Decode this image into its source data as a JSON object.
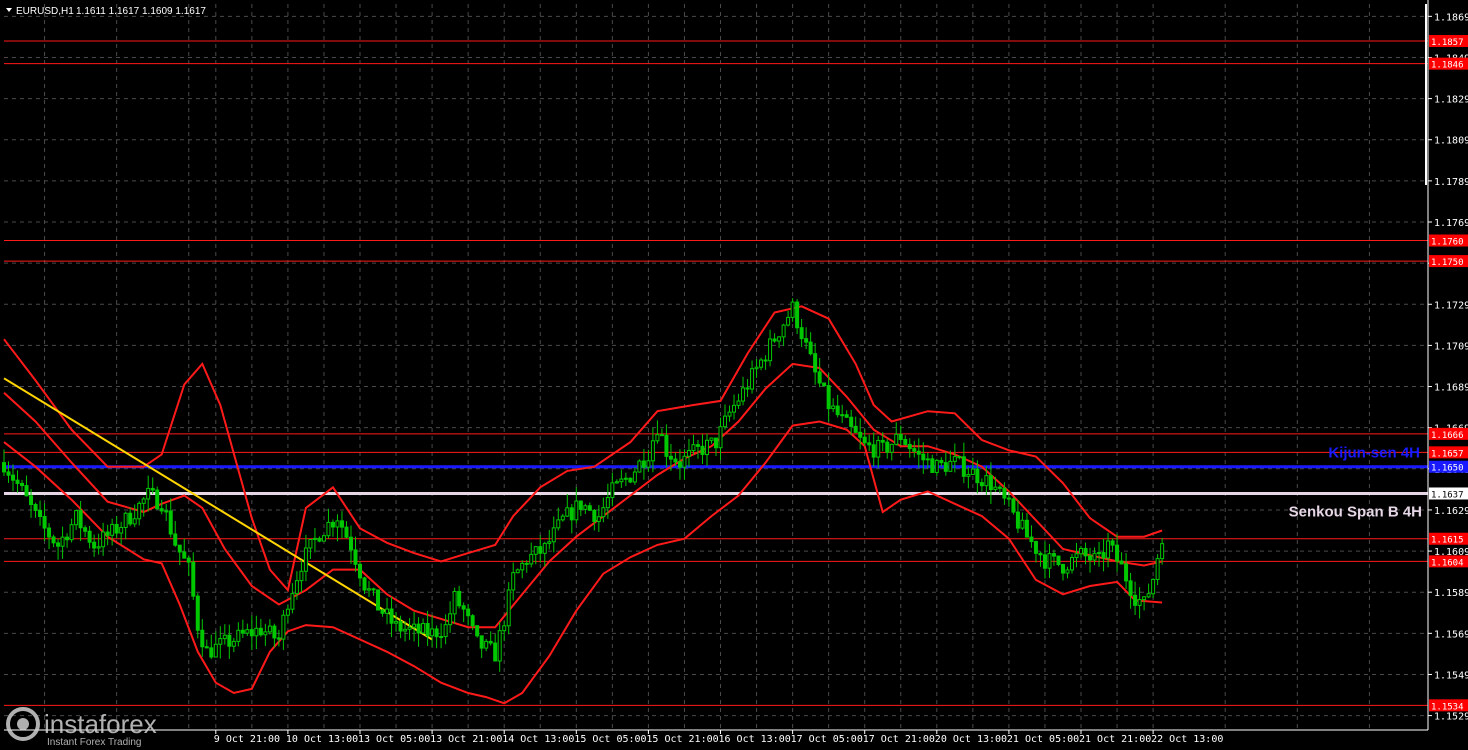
{
  "header": {
    "symbol": "EURUSD,H1",
    "ohlc": "1.1611 1.1617 1.1609 1.1617"
  },
  "watermark": {
    "brand": "instaforex",
    "tagline": "Instant Forex Trading"
  },
  "colors": {
    "background": "#000000",
    "grid": "#4a4a4a",
    "axis": "#ffffff",
    "candle": "#00c800",
    "bollinger": "#ff1a1a",
    "level_line": "#ff1a1a",
    "trend_line": "#ffd400",
    "kijun": "#1a1aff",
    "senkou": "#e6d6e6",
    "label_box": "#ff0000",
    "label_text": "#ffffff"
  },
  "chart_data": {
    "type": "candlestick",
    "symbol": "EURUSD",
    "timeframe": "H1",
    "ylim": [
      1.1522,
      1.1875
    ],
    "grid": true,
    "y_ticks": [
      "1.1869",
      "1.1849",
      "1.1829",
      "1.1809",
      "1.1789",
      "1.1769",
      "1.1749",
      "1.1729",
      "1.1709",
      "1.1689",
      "1.1669",
      "1.1649",
      "1.1629",
      "1.1609",
      "1.1589",
      "1.1569",
      "1.1549",
      "1.1529"
    ],
    "x_ticks": [
      {
        "label": "9 Oct 21:00",
        "x": 12
      },
      {
        "label": "10 Oct 13:00",
        "x": 28
      },
      {
        "label": "13 Oct 05:00",
        "x": 44
      },
      {
        "label": "13 Oct 21:00",
        "x": 60
      },
      {
        "label": "14 Oct 13:00",
        "x": 76
      },
      {
        "label": "15 Oct 05:00",
        "x": 92
      },
      {
        "label": "15 Oct 21:00",
        "x": 108
      },
      {
        "label": "16 Oct 13:00",
        "x": 124
      },
      {
        "label": "17 Oct 05:00",
        "x": 140
      },
      {
        "label": "17 Oct 21:00",
        "x": 156
      },
      {
        "label": "20 Oct 13:00",
        "x": 172
      },
      {
        "label": "21 Oct 05:00",
        "x": 188
      },
      {
        "label": "21 Oct 21:00",
        "x": 204
      },
      {
        "label": "22 Oct 13:00",
        "x": 220
      }
    ],
    "x_range": [
      -35,
      281
    ],
    "levels": [
      {
        "value": 1.1857,
        "label": "1.1857",
        "kind": "resistance"
      },
      {
        "value": 1.1846,
        "label": "1.1846",
        "kind": "resistance"
      },
      {
        "value": 1.176,
        "label": "1.1760",
        "kind": "resistance"
      },
      {
        "value": 1.175,
        "label": "1.1750",
        "kind": "resistance"
      },
      {
        "value": 1.1666,
        "label": "1.1666",
        "kind": "resistance"
      },
      {
        "value": 1.1657,
        "label": "1.1657",
        "kind": "resistance"
      },
      {
        "value": 1.1615,
        "label": "1.1615",
        "kind": "support"
      },
      {
        "value": 1.1604,
        "label": "1.1604",
        "kind": "support"
      },
      {
        "value": 1.1534,
        "label": "1.1534",
        "kind": "support"
      }
    ],
    "indicators": [
      {
        "name": "Kijun-sen 4H",
        "value": 1.165,
        "label": "1.1650"
      },
      {
        "name": "Senkou Span B 4H",
        "value": 1.1637,
        "label": "1.1637"
      }
    ],
    "trend_line": {
      "from": {
        "x": -35,
        "y": 1.1693
      },
      "to": {
        "x": 60,
        "y": 1.1566
      }
    },
    "price_path": [
      [
        -35,
        1.1652
      ],
      [
        -31,
        1.1638
      ],
      [
        -27,
        1.1622
      ],
      [
        -23,
        1.1612
      ],
      [
        -19,
        1.1625
      ],
      [
        -15,
        1.1612
      ],
      [
        -11,
        1.1618
      ],
      [
        -7,
        1.1626
      ],
      [
        -3,
        1.1636
      ],
      [
        0,
        1.1633
      ],
      [
        3,
        1.1613
      ],
      [
        6,
        1.16
      ],
      [
        8,
        1.1573
      ],
      [
        10,
        1.156
      ],
      [
        14,
        1.1564
      ],
      [
        18,
        1.1568
      ],
      [
        22,
        1.1571
      ],
      [
        26,
        1.1566
      ],
      [
        28,
        1.1585
      ],
      [
        31,
        1.1603
      ],
      [
        35,
        1.1618
      ],
      [
        39,
        1.1626
      ],
      [
        42,
        1.1612
      ],
      [
        45,
        1.1593
      ],
      [
        48,
        1.1582
      ],
      [
        52,
        1.1572
      ],
      [
        56,
        1.157
      ],
      [
        60,
        1.1569
      ],
      [
        63,
        1.1572
      ],
      [
        65,
        1.1586
      ],
      [
        67,
        1.158
      ],
      [
        70,
        1.1564
      ],
      [
        74,
        1.1559
      ],
      [
        76,
        1.1576
      ],
      [
        78,
        1.1596
      ],
      [
        81,
        1.1605
      ],
      [
        85,
        1.161
      ],
      [
        89,
        1.1624
      ],
      [
        93,
        1.1632
      ],
      [
        97,
        1.1626
      ],
      [
        100,
        1.1638
      ],
      [
        104,
        1.1646
      ],
      [
        108,
        1.1657
      ],
      [
        110,
        1.167
      ],
      [
        112,
        1.1658
      ],
      [
        115,
        1.1652
      ],
      [
        119,
        1.1658
      ],
      [
        123,
        1.1662
      ],
      [
        126,
        1.1676
      ],
      [
        130,
        1.169
      ],
      [
        134,
        1.1705
      ],
      [
        138,
        1.172
      ],
      [
        140,
        1.1727
      ],
      [
        142,
        1.1715
      ],
      [
        145,
        1.1695
      ],
      [
        148,
        1.168
      ],
      [
        152,
        1.167
      ],
      [
        156,
        1.166
      ],
      [
        160,
        1.1658
      ],
      [
        164,
        1.1665
      ],
      [
        168,
        1.1655
      ],
      [
        172,
        1.165
      ],
      [
        176,
        1.1652
      ],
      [
        180,
        1.1647
      ],
      [
        184,
        1.1642
      ],
      [
        188,
        1.163
      ],
      [
        192,
        1.1616
      ],
      [
        196,
        1.1605
      ],
      [
        200,
        1.1602
      ],
      [
        204,
        1.1607
      ],
      [
        208,
        1.1604
      ],
      [
        210,
        1.1612
      ],
      [
        213,
        1.1601
      ],
      [
        216,
        1.1587
      ],
      [
        218,
        1.1583
      ],
      [
        220,
        1.1596
      ],
      [
        222,
        1.1617
      ]
    ],
    "bollinger": {
      "upper": [
        [
          -35,
          1.1712
        ],
        [
          -28,
          1.1692
        ],
        [
          -20,
          1.1668
        ],
        [
          -12,
          1.165
        ],
        [
          -4,
          1.165
        ],
        [
          0,
          1.1656
        ],
        [
          5,
          1.169
        ],
        [
          9,
          1.17
        ],
        [
          13,
          1.168
        ],
        [
          20,
          1.1625
        ],
        [
          24,
          1.16
        ],
        [
          28,
          1.159
        ],
        [
          32,
          1.163
        ],
        [
          38,
          1.164
        ],
        [
          44,
          1.162
        ],
        [
          50,
          1.1613
        ],
        [
          56,
          1.1608
        ],
        [
          62,
          1.1604
        ],
        [
          68,
          1.1608
        ],
        [
          74,
          1.1612
        ],
        [
          78,
          1.1626
        ],
        [
          84,
          1.164
        ],
        [
          90,
          1.1648
        ],
        [
          96,
          1.165
        ],
        [
          104,
          1.1662
        ],
        [
          110,
          1.1677
        ],
        [
          118,
          1.168
        ],
        [
          124,
          1.1682
        ],
        [
          130,
          1.1705
        ],
        [
          136,
          1.1725
        ],
        [
          142,
          1.1728
        ],
        [
          148,
          1.1722
        ],
        [
          154,
          1.17
        ],
        [
          158,
          1.168
        ],
        [
          162,
          1.1672
        ],
        [
          170,
          1.1677
        ],
        [
          176,
          1.1676
        ],
        [
          182,
          1.1663
        ],
        [
          188,
          1.1658
        ],
        [
          194,
          1.1655
        ],
        [
          200,
          1.1642
        ],
        [
          206,
          1.1625
        ],
        [
          212,
          1.1616
        ],
        [
          218,
          1.1616
        ],
        [
          222,
          1.1619
        ]
      ],
      "middle": [
        [
          -35,
          1.1686
        ],
        [
          -28,
          1.1672
        ],
        [
          -20,
          1.1652
        ],
        [
          -12,
          1.1633
        ],
        [
          -4,
          1.1628
        ],
        [
          0,
          1.1632
        ],
        [
          5,
          1.1636
        ],
        [
          9,
          1.163
        ],
        [
          14,
          1.161
        ],
        [
          20,
          1.1592
        ],
        [
          26,
          1.1583
        ],
        [
          32,
          1.159
        ],
        [
          38,
          1.16
        ],
        [
          44,
          1.16
        ],
        [
          50,
          1.1588
        ],
        [
          56,
          1.158
        ],
        [
          62,
          1.1576
        ],
        [
          68,
          1.1572
        ],
        [
          74,
          1.1572
        ],
        [
          80,
          1.1588
        ],
        [
          86,
          1.1604
        ],
        [
          92,
          1.1616
        ],
        [
          98,
          1.1626
        ],
        [
          104,
          1.1636
        ],
        [
          110,
          1.1646
        ],
        [
          116,
          1.1654
        ],
        [
          122,
          1.166
        ],
        [
          128,
          1.1672
        ],
        [
          134,
          1.1688
        ],
        [
          140,
          1.17
        ],
        [
          146,
          1.1698
        ],
        [
          152,
          1.1684
        ],
        [
          158,
          1.1668
        ],
        [
          164,
          1.166
        ],
        [
          170,
          1.166
        ],
        [
          176,
          1.1656
        ],
        [
          182,
          1.165
        ],
        [
          188,
          1.1638
        ],
        [
          194,
          1.1624
        ],
        [
          200,
          1.161
        ],
        [
          206,
          1.1607
        ],
        [
          212,
          1.1604
        ],
        [
          218,
          1.1602
        ],
        [
          222,
          1.1604
        ]
      ],
      "lower": [
        [
          -35,
          1.1662
        ],
        [
          -28,
          1.165
        ],
        [
          -20,
          1.1634
        ],
        [
          -12,
          1.1616
        ],
        [
          -4,
          1.1605
        ],
        [
          0,
          1.1603
        ],
        [
          4,
          1.1583
        ],
        [
          8,
          1.156
        ],
        [
          12,
          1.1545
        ],
        [
          16,
          1.154
        ],
        [
          20,
          1.1542
        ],
        [
          24,
          1.156
        ],
        [
          28,
          1.157
        ],
        [
          32,
          1.1573
        ],
        [
          38,
          1.1572
        ],
        [
          44,
          1.1566
        ],
        [
          50,
          1.156
        ],
        [
          56,
          1.1553
        ],
        [
          62,
          1.1545
        ],
        [
          68,
          1.154
        ],
        [
          72,
          1.1538
        ],
        [
          76,
          1.1535
        ],
        [
          80,
          1.154
        ],
        [
          86,
          1.1558
        ],
        [
          92,
          1.158
        ],
        [
          98,
          1.1598
        ],
        [
          104,
          1.1606
        ],
        [
          110,
          1.1612
        ],
        [
          116,
          1.1615
        ],
        [
          122,
          1.1626
        ],
        [
          128,
          1.1636
        ],
        [
          134,
          1.1652
        ],
        [
          140,
          1.167
        ],
        [
          146,
          1.1672
        ],
        [
          152,
          1.1668
        ],
        [
          156,
          1.166
        ],
        [
          160,
          1.1628
        ],
        [
          164,
          1.1634
        ],
        [
          170,
          1.1638
        ],
        [
          176,
          1.1632
        ],
        [
          182,
          1.1626
        ],
        [
          188,
          1.1615
        ],
        [
          194,
          1.1595
        ],
        [
          200,
          1.1588
        ],
        [
          206,
          1.1592
        ],
        [
          212,
          1.1594
        ],
        [
          216,
          1.1585
        ],
        [
          222,
          1.1584
        ]
      ]
    }
  }
}
